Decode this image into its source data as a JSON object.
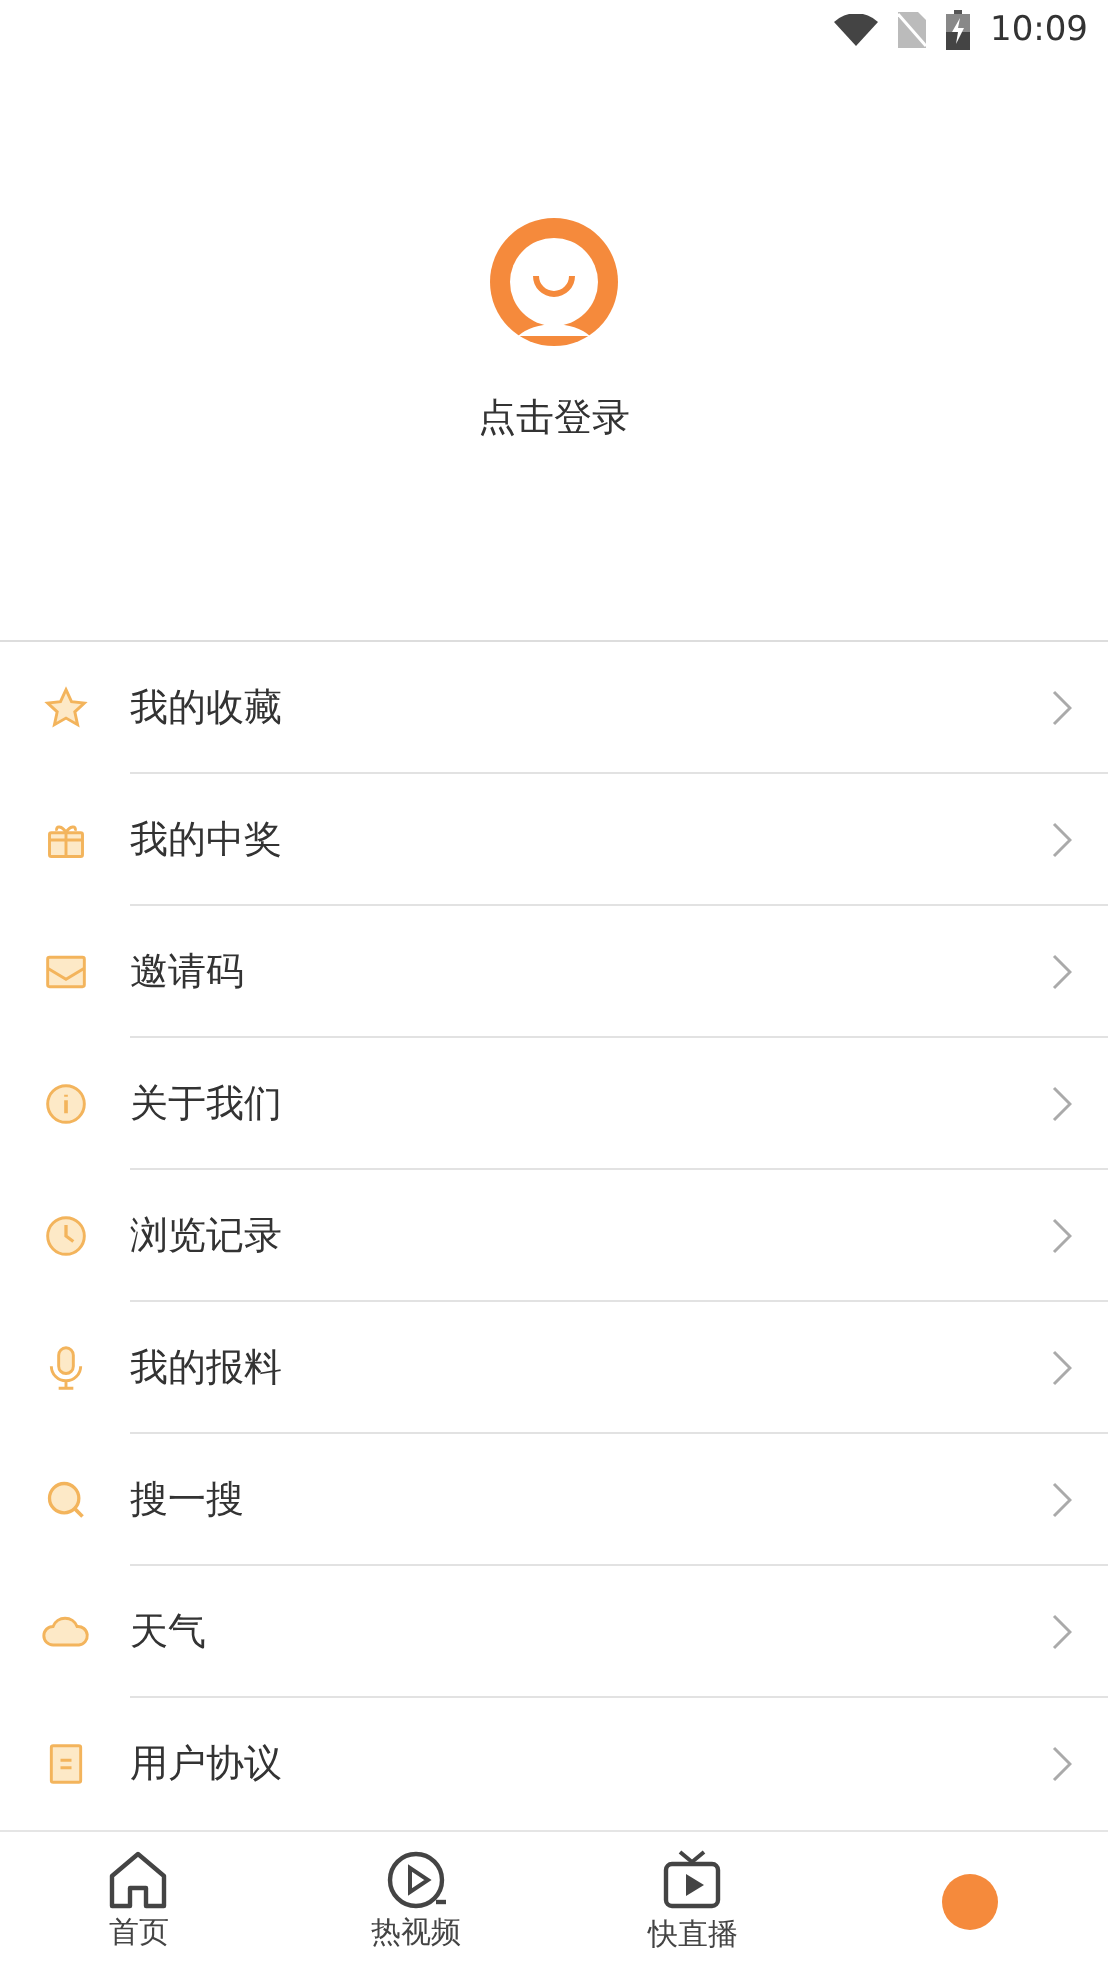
{
  "status_bar": {
    "time": "10:09"
  },
  "profile": {
    "login_label": "点击登录"
  },
  "menu": [
    {
      "label": "我的收藏"
    },
    {
      "label": "我的中奖"
    },
    {
      "label": "邀请码"
    },
    {
      "label": "关于我们"
    },
    {
      "label": "浏览记录"
    },
    {
      "label": "我的报料"
    },
    {
      "label": "搜一搜"
    },
    {
      "label": "天气"
    },
    {
      "label": "用户协议"
    }
  ],
  "tabs": [
    {
      "label": "首页",
      "selected": false
    },
    {
      "label": "热视频",
      "selected": false
    },
    {
      "label": "快直播",
      "selected": false
    },
    {
      "selected": true
    }
  ]
}
